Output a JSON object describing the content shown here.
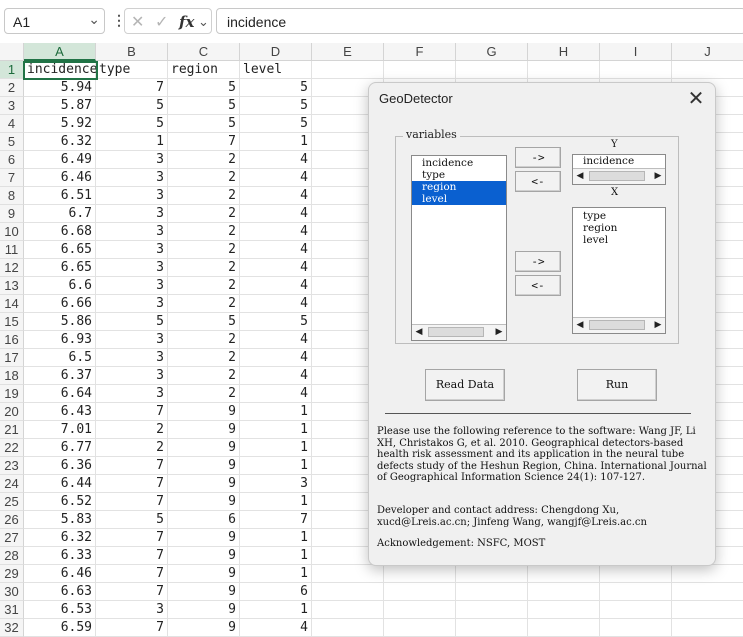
{
  "formula_bar": {
    "name_box": "A1",
    "content": "incidence"
  },
  "columns": [
    "A",
    "B",
    "C",
    "D",
    "E",
    "F",
    "G",
    "H",
    "I",
    "J"
  ],
  "rows": [
    [
      "incidence",
      "type",
      "region",
      "level"
    ],
    [
      "5.94",
      "7",
      "5",
      "5"
    ],
    [
      "5.87",
      "5",
      "5",
      "5"
    ],
    [
      "5.92",
      "5",
      "5",
      "5"
    ],
    [
      "6.32",
      "1",
      "7",
      "1"
    ],
    [
      "6.49",
      "3",
      "2",
      "4"
    ],
    [
      "6.46",
      "3",
      "2",
      "4"
    ],
    [
      "6.51",
      "3",
      "2",
      "4"
    ],
    [
      "6.7",
      "3",
      "2",
      "4"
    ],
    [
      "6.68",
      "3",
      "2",
      "4"
    ],
    [
      "6.65",
      "3",
      "2",
      "4"
    ],
    [
      "6.65",
      "3",
      "2",
      "4"
    ],
    [
      "6.6",
      "3",
      "2",
      "4"
    ],
    [
      "6.66",
      "3",
      "2",
      "4"
    ],
    [
      "5.86",
      "5",
      "5",
      "5"
    ],
    [
      "6.93",
      "3",
      "2",
      "4"
    ],
    [
      "6.5",
      "3",
      "2",
      "4"
    ],
    [
      "6.37",
      "3",
      "2",
      "4"
    ],
    [
      "6.64",
      "3",
      "2",
      "4"
    ],
    [
      "6.43",
      "7",
      "9",
      "1"
    ],
    [
      "7.01",
      "2",
      "9",
      "1"
    ],
    [
      "6.77",
      "2",
      "9",
      "1"
    ],
    [
      "6.36",
      "7",
      "9",
      "1"
    ],
    [
      "6.44",
      "7",
      "9",
      "3"
    ],
    [
      "6.52",
      "7",
      "9",
      "1"
    ],
    [
      "5.83",
      "5",
      "6",
      "7"
    ],
    [
      "6.32",
      "7",
      "9",
      "1"
    ],
    [
      "6.33",
      "7",
      "9",
      "1"
    ],
    [
      "6.46",
      "7",
      "9",
      "1"
    ],
    [
      "6.63",
      "7",
      "9",
      "6"
    ],
    [
      "6.53",
      "3",
      "9",
      "1"
    ],
    [
      "6.59",
      "7",
      "9",
      "4"
    ]
  ],
  "dialog": {
    "title": "GeoDetector",
    "variables_label": "variables",
    "available_list": [
      {
        "label": "incidence",
        "selected": false
      },
      {
        "label": "type",
        "selected": false
      },
      {
        "label": "region",
        "selected": true
      },
      {
        "label": "level",
        "selected": true
      }
    ],
    "y_label": "Y",
    "y_value": "incidence",
    "x_label": "X",
    "x_list": [
      "type",
      "region",
      "level"
    ],
    "add_y_button": "->",
    "remove_y_button": "<-",
    "add_x_button": "->",
    "remove_x_button": "<-",
    "read_data_button": "Read Data",
    "run_button": "Run",
    "reference_text": "Please use the following reference to the software: Wang JF, Li XH, Christakos G, et al. 2010. Geographical detectors-based health risk assessment and its application in the neural tube defects study of the Heshun Region, China. International Journal of Geographical Information Science 24(1): 107-127.",
    "contact_text": "Developer and contact address: Chengdong Xu, xucd@Lreis.ac.cn; Jinfeng Wang, wangjf@Lreis.ac.cn",
    "acknowledgement_text": "Acknowledgement: NSFC, MOST"
  }
}
